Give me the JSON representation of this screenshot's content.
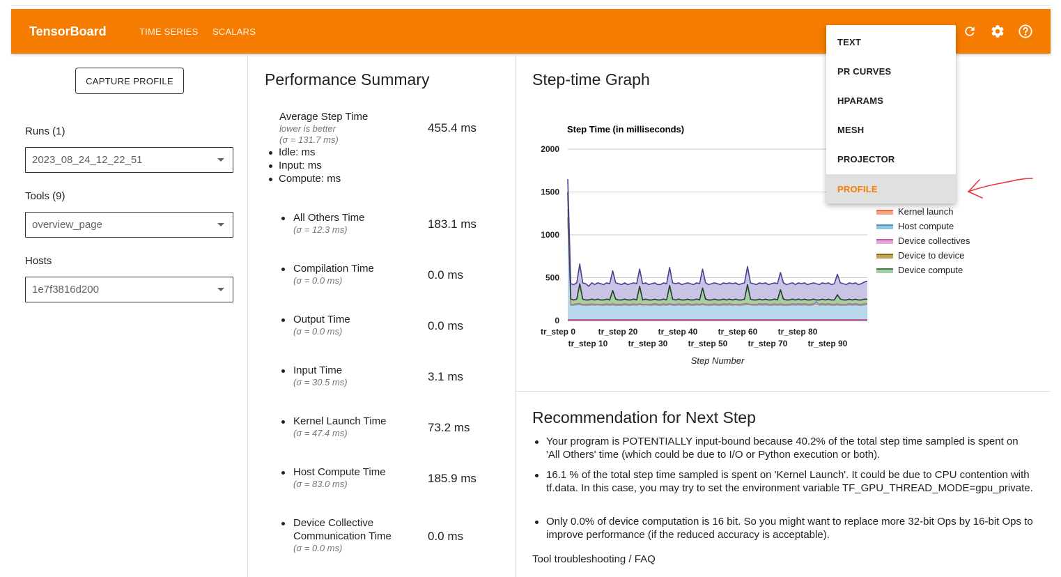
{
  "toolbar": {
    "brand": "TensorBoard",
    "tabs": [
      "TIME SERIES",
      "SCALARS"
    ],
    "icons": [
      "refresh-icon",
      "settings-icon",
      "help-icon"
    ]
  },
  "dropdown": {
    "items": [
      "TEXT",
      "PR CURVES",
      "HPARAMS",
      "MESH",
      "PROJECTOR",
      "PROFILE"
    ],
    "active": "PROFILE"
  },
  "sidebar": {
    "capture_label": "CAPTURE PROFILE",
    "runs_label": "Runs (1)",
    "runs_value": "2023_08_24_12_22_51",
    "tools_label": "Tools (9)",
    "tools_value": "overview_page",
    "hosts_label": "Hosts",
    "hosts_value": "1e7f3816d200"
  },
  "summary": {
    "title": "Performance Summary",
    "avg": {
      "name": "Average Step Time",
      "note": "lower is better",
      "sigma": "(σ = 131.7 ms)",
      "value": "455.4 ms",
      "subs": [
        "Idle: ms",
        "Input: ms",
        "Compute: ms"
      ]
    },
    "metrics": [
      {
        "name": "All Others Time",
        "sigma": "(σ = 12.3 ms)",
        "value": "183.1 ms"
      },
      {
        "name": "Compilation Time",
        "sigma": "(σ = 0.0 ms)",
        "value": "0.0 ms"
      },
      {
        "name": "Output Time",
        "sigma": "(σ = 0.0 ms)",
        "value": "0.0 ms"
      },
      {
        "name": "Input Time",
        "sigma": "(σ = 30.5 ms)",
        "value": "3.1 ms"
      },
      {
        "name": "Kernel Launch Time",
        "sigma": "(σ = 47.4 ms)",
        "value": "73.2 ms"
      },
      {
        "name": "Host Compute Time",
        "sigma": "(σ = 83.0 ms)",
        "value": "185.9 ms"
      },
      {
        "name": "Device Collective",
        "name2": "Communication Time",
        "sigma": "(σ = 0.0 ms)",
        "value": "0.0 ms"
      }
    ]
  },
  "graph": {
    "title": "Step-time Graph"
  },
  "chart_data": {
    "type": "area",
    "title": "Step Time (in milliseconds)",
    "xlabel": "Step Number",
    "ylabel": "",
    "ylim": [
      0,
      2000
    ],
    "yticks": [
      0,
      500,
      1000,
      1500,
      2000
    ],
    "xtick_labels_row1": [
      "tr_step 0",
      "tr_step 20",
      "tr_step 40",
      "tr_step 60",
      "tr_step 80"
    ],
    "xtick_labels_row2": [
      "tr_step 10",
      "tr_step 30",
      "tr_step 50",
      "tr_step 70",
      "tr_step 90"
    ],
    "grid": true,
    "legend_visible": [
      {
        "name": "Kernel launch",
        "color": "#f4a582"
      },
      {
        "name": "Host compute",
        "color": "#92c5de"
      },
      {
        "name": "Device collectives",
        "color": "#e7a6d8"
      },
      {
        "name": "Device to device",
        "color": "#c2a35a"
      },
      {
        "name": "Device compute",
        "color": "#a6cfa6"
      }
    ],
    "total_step_time": [
      1650,
      430,
      420,
      440,
      660,
      440,
      430,
      400,
      440,
      420,
      440,
      430,
      420,
      440,
      430,
      580,
      440,
      430,
      420,
      440,
      420,
      430,
      440,
      430,
      600,
      430,
      440,
      420,
      430,
      440,
      420,
      420,
      440,
      430,
      620,
      440,
      430,
      440,
      420,
      430,
      440,
      430,
      420,
      440,
      430,
      600,
      440,
      420,
      430,
      440,
      430,
      420,
      440,
      430,
      440,
      430,
      440,
      420,
      430,
      440,
      630,
      440,
      430,
      420,
      440,
      430,
      440,
      420,
      430,
      440,
      430,
      560,
      440,
      420,
      430,
      440,
      420,
      440,
      430,
      440,
      420,
      430,
      440,
      430,
      420,
      440,
      430,
      440,
      420,
      430,
      540,
      440,
      430,
      420,
      440,
      430,
      440,
      420,
      430,
      450,
      460
    ],
    "device_compute_top": [
      1500,
      250,
      240,
      250,
      430,
      250,
      240,
      240,
      250,
      240,
      250,
      240,
      240,
      250,
      240,
      350,
      250,
      240,
      240,
      250,
      240,
      240,
      250,
      240,
      400,
      240,
      250,
      240,
      240,
      250,
      240,
      240,
      250,
      240,
      410,
      250,
      240,
      250,
      240,
      240,
      250,
      240,
      240,
      250,
      240,
      380,
      250,
      240,
      240,
      250,
      240,
      240,
      250,
      240,
      250,
      240,
      250,
      240,
      240,
      250,
      420,
      250,
      240,
      240,
      250,
      240,
      250,
      240,
      240,
      250,
      240,
      360,
      250,
      240,
      240,
      250,
      240,
      250,
      240,
      250,
      240,
      240,
      250,
      240,
      240,
      250,
      240,
      250,
      240,
      240,
      300,
      250,
      240,
      240,
      250,
      240,
      250,
      240,
      240,
      250,
      250
    ],
    "kernel_launch_top": [
      1300,
      190,
      190,
      200,
      200,
      190,
      190,
      190,
      200,
      190,
      190,
      190,
      190,
      200,
      190,
      200,
      190,
      190,
      190,
      200,
      190,
      190,
      200,
      190,
      200,
      190,
      190,
      190,
      190,
      200,
      190,
      190,
      200,
      190,
      200,
      190,
      190,
      200,
      190,
      190,
      200,
      190,
      190,
      200,
      190,
      200,
      190,
      190,
      190,
      200,
      190,
      190,
      200,
      190,
      200,
      190,
      190,
      190,
      190,
      200,
      200,
      190,
      190,
      190,
      200,
      190,
      200,
      190,
      190,
      200,
      190,
      200,
      190,
      190,
      190,
      200,
      190,
      200,
      190,
      200,
      190,
      190,
      200,
      190,
      190,
      200,
      190,
      200,
      190,
      190,
      200,
      190,
      190,
      190,
      200,
      190,
      200,
      190,
      190,
      200,
      200
    ],
    "host_compute_top": [
      1200,
      180,
      180,
      185,
      190,
      180,
      180,
      180,
      185,
      180,
      185,
      180,
      180,
      185,
      180,
      185,
      180,
      180,
      180,
      185,
      180,
      180,
      185,
      180,
      190,
      180,
      185,
      180,
      180,
      185,
      180,
      180,
      185,
      180,
      190,
      180,
      180,
      185,
      180,
      180,
      185,
      180,
      180,
      185,
      180,
      190,
      180,
      180,
      180,
      185,
      180,
      180,
      185,
      180,
      185,
      180,
      185,
      180,
      180,
      185,
      190,
      185,
      180,
      180,
      185,
      180,
      185,
      180,
      180,
      185,
      180,
      185,
      180,
      180,
      180,
      185,
      180,
      185,
      180,
      185,
      180,
      180,
      185,
      220,
      180,
      185,
      180,
      185,
      180,
      180,
      185,
      180,
      180,
      180,
      185,
      180,
      185,
      180,
      180,
      185,
      190
    ]
  },
  "recommendation": {
    "title": "Recommendation for Next Step",
    "items": [
      "Your program is POTENTIALLY input-bound because 40.2% of the total step time sampled is spent on 'All Others' time (which could be due to I/O or Python execution or both).",
      "16.1 % of the total step time sampled is spent on 'Kernel Launch'. It could be due to CPU contention with tf.data. In this case, you may try to set the environment variable TF_GPU_THREAD_MODE=gpu_private.",
      "Only 0.0% of device computation is 16 bit. So you might want to replace more 32-bit Ops by 16-bit Ops to improve performance (if the reduced accuracy is acceptable)."
    ],
    "faq": "Tool troubleshooting / FAQ"
  },
  "colors": {
    "brand": "#f57c00",
    "annotation_arrow": "#e53935",
    "total_area": "#c9c3e6",
    "total_line": "#4b3f8f",
    "device_compute_line": "#1f3d2b",
    "host_compute_area": "#b9d7ea"
  }
}
